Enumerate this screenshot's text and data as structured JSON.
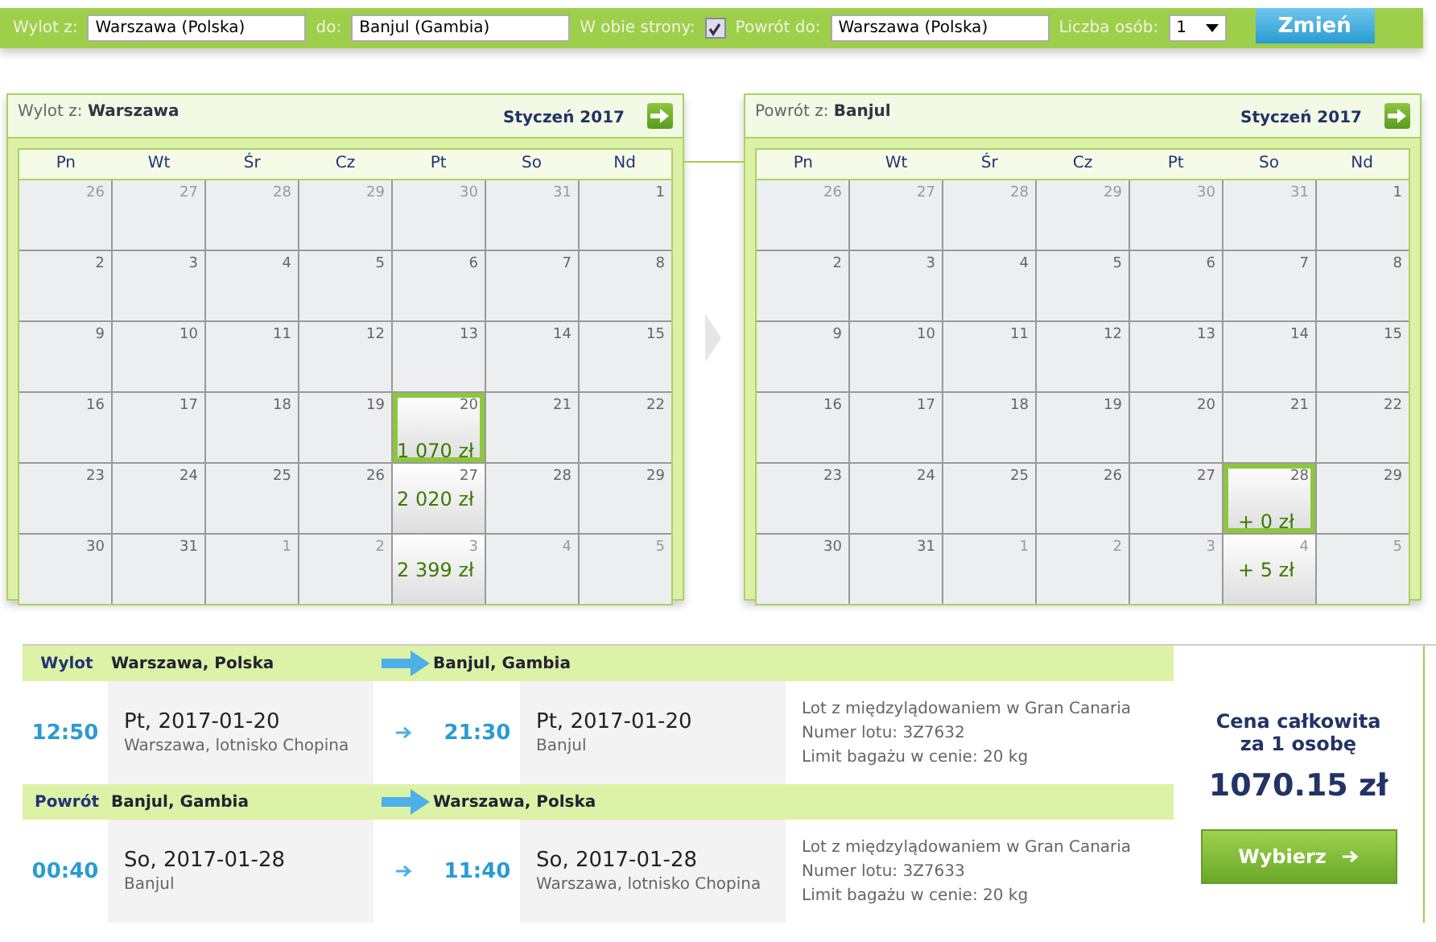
{
  "search_bar": {
    "from_label": "Wylot z:",
    "from_value": "Warszawa (Polska)",
    "to_label": "do:",
    "to_value": "Banjul (Gambia)",
    "round_trip_label": "W obie strony:",
    "round_trip_checked": true,
    "return_label": "Powrót do:",
    "return_value": "Warszawa (Polska)",
    "passengers_label": "Liczba osób:",
    "passengers_value": "1",
    "submit": "Zmień"
  },
  "calendars": [
    {
      "label": "Wylot z:",
      "city": "Warszawa",
      "month": "Styczeń 2017",
      "weekdays": [
        "Pn",
        "Wt",
        "Śr",
        "Cz",
        "Pt",
        "So",
        "Nd"
      ],
      "weeks": [
        [
          {
            "day": "26",
            "muted": true
          },
          {
            "day": "27",
            "muted": true
          },
          {
            "day": "28",
            "muted": true
          },
          {
            "day": "29",
            "muted": true
          },
          {
            "day": "30",
            "muted": true
          },
          {
            "day": "31",
            "muted": true
          },
          {
            "day": "1",
            "muted": false
          }
        ],
        [
          {
            "day": "2",
            "muted": false
          },
          {
            "day": "3",
            "muted": false
          },
          {
            "day": "4",
            "muted": false
          },
          {
            "day": "5",
            "muted": false
          },
          {
            "day": "6",
            "muted": false
          },
          {
            "day": "7",
            "muted": false
          },
          {
            "day": "8",
            "muted": false
          }
        ],
        [
          {
            "day": "9",
            "muted": false
          },
          {
            "day": "10",
            "muted": false
          },
          {
            "day": "11",
            "muted": false
          },
          {
            "day": "12",
            "muted": false
          },
          {
            "day": "13",
            "muted": false
          },
          {
            "day": "14",
            "muted": false
          },
          {
            "day": "15",
            "muted": false
          }
        ],
        [
          {
            "day": "16",
            "muted": false
          },
          {
            "day": "17",
            "muted": false
          },
          {
            "day": "18",
            "muted": false
          },
          {
            "day": "19",
            "muted": false
          },
          {
            "day": "20",
            "muted": false,
            "price": "1 070 zł",
            "selected": true
          },
          {
            "day": "21",
            "muted": false
          },
          {
            "day": "22",
            "muted": false
          }
        ],
        [
          {
            "day": "23",
            "muted": false
          },
          {
            "day": "24",
            "muted": false
          },
          {
            "day": "25",
            "muted": false
          },
          {
            "day": "26",
            "muted": false
          },
          {
            "day": "27",
            "muted": false,
            "price": "2 020 zł",
            "selected": false
          },
          {
            "day": "28",
            "muted": false
          },
          {
            "day": "29",
            "muted": false
          }
        ],
        [
          {
            "day": "30",
            "muted": false
          },
          {
            "day": "31",
            "muted": false
          },
          {
            "day": "1",
            "muted": true
          },
          {
            "day": "2",
            "muted": true
          },
          {
            "day": "3",
            "muted": true,
            "price": "2 399 zł",
            "selected": false
          },
          {
            "day": "4",
            "muted": true
          },
          {
            "day": "5",
            "muted": true
          }
        ]
      ]
    },
    {
      "label": "Powrót z:",
      "city": "Banjul",
      "month": "Styczeń 2017",
      "weekdays": [
        "Pn",
        "Wt",
        "Śr",
        "Cz",
        "Pt",
        "So",
        "Nd"
      ],
      "weeks": [
        [
          {
            "day": "26",
            "muted": true
          },
          {
            "day": "27",
            "muted": true
          },
          {
            "day": "28",
            "muted": true
          },
          {
            "day": "29",
            "muted": true
          },
          {
            "day": "30",
            "muted": true
          },
          {
            "day": "31",
            "muted": true
          },
          {
            "day": "1",
            "muted": false
          }
        ],
        [
          {
            "day": "2",
            "muted": false
          },
          {
            "day": "3",
            "muted": false
          },
          {
            "day": "4",
            "muted": false
          },
          {
            "day": "5",
            "muted": false
          },
          {
            "day": "6",
            "muted": false
          },
          {
            "day": "7",
            "muted": false
          },
          {
            "day": "8",
            "muted": false
          }
        ],
        [
          {
            "day": "9",
            "muted": false
          },
          {
            "day": "10",
            "muted": false
          },
          {
            "day": "11",
            "muted": false
          },
          {
            "day": "12",
            "muted": false
          },
          {
            "day": "13",
            "muted": false
          },
          {
            "day": "14",
            "muted": false
          },
          {
            "day": "15",
            "muted": false
          }
        ],
        [
          {
            "day": "16",
            "muted": false
          },
          {
            "day": "17",
            "muted": false
          },
          {
            "day": "18",
            "muted": false
          },
          {
            "day": "19",
            "muted": false
          },
          {
            "day": "20",
            "muted": false
          },
          {
            "day": "21",
            "muted": false
          },
          {
            "day": "22",
            "muted": false
          }
        ],
        [
          {
            "day": "23",
            "muted": false
          },
          {
            "day": "24",
            "muted": false
          },
          {
            "day": "25",
            "muted": false
          },
          {
            "day": "26",
            "muted": false
          },
          {
            "day": "27",
            "muted": false
          },
          {
            "day": "28",
            "muted": false,
            "price": "+ 0 zł",
            "selected": true
          },
          {
            "day": "29",
            "muted": false
          }
        ],
        [
          {
            "day": "30",
            "muted": false
          },
          {
            "day": "31",
            "muted": false
          },
          {
            "day": "1",
            "muted": true
          },
          {
            "day": "2",
            "muted": true
          },
          {
            "day": "3",
            "muted": true
          },
          {
            "day": "4",
            "muted": true,
            "price": "+ 5 zł",
            "selected": false
          },
          {
            "day": "5",
            "muted": true
          }
        ]
      ]
    }
  ],
  "legs": [
    {
      "label": "Wylot",
      "from": "Warszawa, Polska",
      "to": "Banjul, Gambia",
      "dep_time": "12:50",
      "dep_date": "Pt, 2017-01-20",
      "dep_place": "Warszawa, lotnisko Chopina",
      "arr_time": "21:30",
      "arr_date": "Pt, 2017-01-20",
      "arr_place": "Banjul",
      "info": [
        "Lot z międzylądowaniem w Gran Canaria",
        "Numer lotu: 3Z7632",
        "Limit bagażu w cenie: 20 kg"
      ]
    },
    {
      "label": "Powrót",
      "from": "Banjul, Gambia",
      "to": "Warszawa, Polska",
      "dep_time": "00:40",
      "dep_date": "So, 2017-01-28",
      "dep_place": "Banjul",
      "arr_time": "11:40",
      "arr_date": "So, 2017-01-28",
      "arr_place": "Warszawa, lotnisko Chopina",
      "info": [
        "Lot z międzylądowaniem w Gran Canaria",
        "Numer lotu: 3Z7633",
        "Limit bagażu w cenie: 20 kg"
      ]
    }
  ],
  "total": {
    "label": "Cena całkowita za 1 osobę",
    "price": "1070.15 zł",
    "button": "Wybierz"
  }
}
